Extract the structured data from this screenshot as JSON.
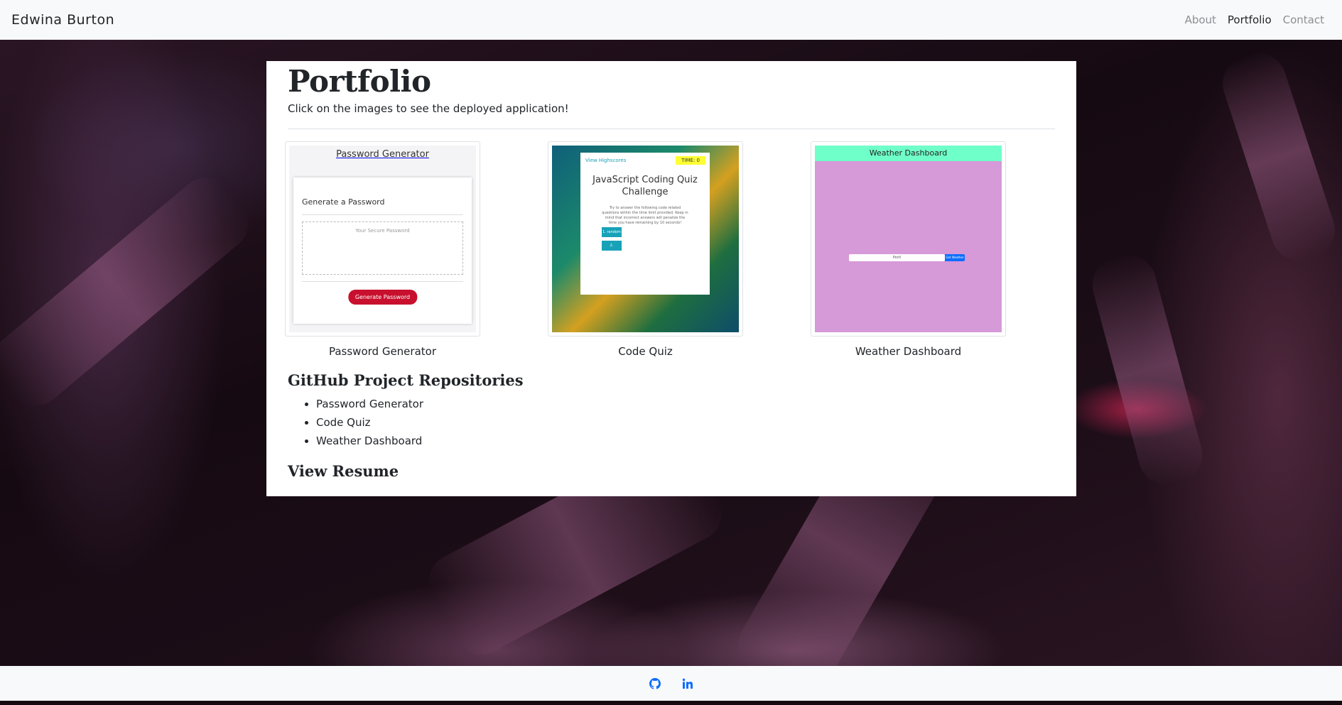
{
  "navbar": {
    "brand": "Edwina Burton",
    "links": [
      {
        "label": "About",
        "active": false
      },
      {
        "label": "Portfolio",
        "active": true
      },
      {
        "label": "Contact",
        "active": false
      }
    ]
  },
  "main": {
    "title": "Portfolio",
    "subtitle": "Click on the images to see the deployed application!",
    "projects": [
      {
        "label": "Password Generator",
        "thumb": {
          "header": "Password Generator",
          "card_title": "Generate a Password",
          "placeholder": "Your Secure Password",
          "button": "Generate Password"
        }
      },
      {
        "label": "Code Quiz",
        "thumb": {
          "highscores": "View Highscores",
          "timer": "TIME: 0",
          "title_line1": "JavaScript Coding Quiz",
          "title_line2": "Challenge",
          "body": "Try to answer the following code related questions within the time limit provided. Keep in mind that incorrect answers will penalize the time you have remaining by 10 seconds!",
          "button1": "1. random",
          "button2": "2. concatenate"
        }
      },
      {
        "label": "Weather Dashboard",
        "thumb": {
          "header": "Weather Dashboard",
          "input_value": "Portl",
          "button": "Get Weather"
        }
      }
    ],
    "repos_title": "GitHub Project Repositories",
    "repos": [
      "Password Generator",
      "Code Quiz",
      "Weather Dashboard"
    ],
    "resume_title": "View Resume"
  },
  "footer": {
    "icons": [
      "github-icon",
      "linkedin-icon"
    ],
    "accent": "#0d6efd"
  }
}
